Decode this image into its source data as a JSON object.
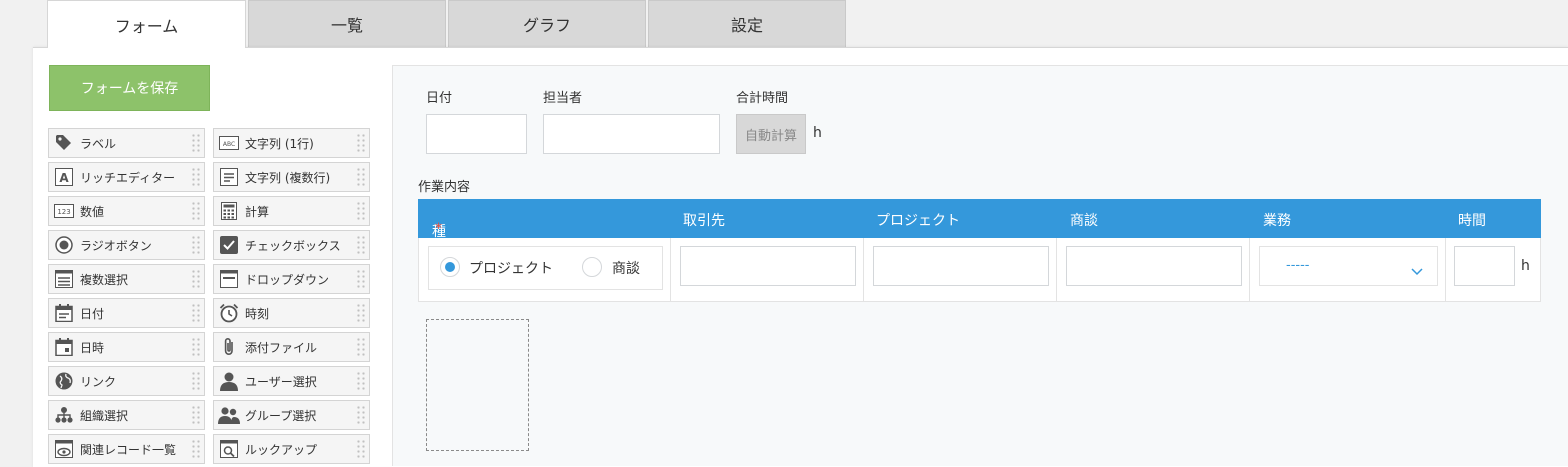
{
  "tabs": [
    "フォーム",
    "一覧",
    "グラフ",
    "設定"
  ],
  "save_button": "フォームを保存",
  "palette": [
    {
      "label": "ラベル",
      "icon": "tag-icon"
    },
    {
      "label": "文字列 (1行)",
      "icon": "text-single-line-icon"
    },
    {
      "label": "リッチエディター",
      "icon": "rich-editor-icon"
    },
    {
      "label": "文字列 (複数行)",
      "icon": "text-multi-line-icon"
    },
    {
      "label": "数値",
      "icon": "number-icon"
    },
    {
      "label": "計算",
      "icon": "calculator-icon"
    },
    {
      "label": "ラジオボタン",
      "icon": "radio-button-icon"
    },
    {
      "label": "チェックボックス",
      "icon": "checkbox-icon"
    },
    {
      "label": "複数選択",
      "icon": "multi-select-icon"
    },
    {
      "label": "ドロップダウン",
      "icon": "dropdown-icon"
    },
    {
      "label": "日付",
      "icon": "date-icon"
    },
    {
      "label": "時刻",
      "icon": "clock-icon"
    },
    {
      "label": "日時",
      "icon": "datetime-icon"
    },
    {
      "label": "添付ファイル",
      "icon": "paperclip-icon"
    },
    {
      "label": "リンク",
      "icon": "globe-icon"
    },
    {
      "label": "ユーザー選択",
      "icon": "user-icon"
    },
    {
      "label": "組織選択",
      "icon": "organization-icon"
    },
    {
      "label": "グループ選択",
      "icon": "group-icon"
    },
    {
      "label": "関連レコード一覧",
      "icon": "related-records-icon"
    },
    {
      "label": "ルックアップ",
      "icon": "lookup-icon"
    }
  ],
  "form": {
    "date_label": "日付",
    "assignee_label": "担当者",
    "total_time_label": "合計時間",
    "total_time_value": "自動計算",
    "total_time_unit": "h",
    "table_label": "作業内容",
    "columns": [
      "種別",
      "取引先",
      "プロジェクト",
      "商談",
      "業務",
      "時間"
    ],
    "required_mark": "*",
    "radio_options": [
      "プロジェクト",
      "商談"
    ],
    "select_value": "-----",
    "time_unit": "h"
  },
  "colors": {
    "accent": "#3498db",
    "save": "#8dc26a",
    "required": "#e74c3c"
  }
}
